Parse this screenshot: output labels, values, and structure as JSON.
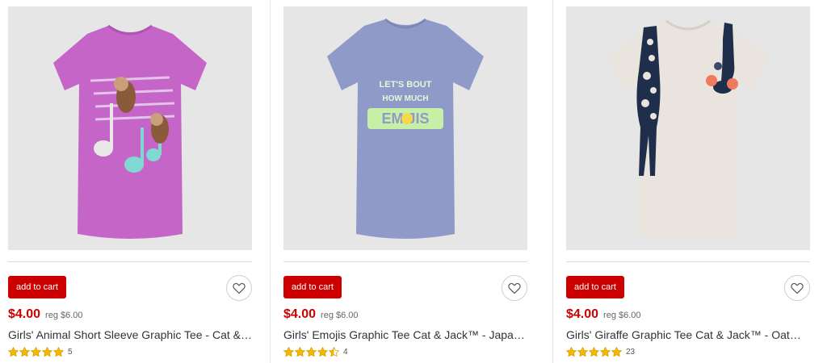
{
  "products": [
    {
      "add_to_cart_label": "add to cart",
      "price": "$4.00",
      "reg_price": "reg $6.00",
      "title": "Girls' Animal Short Sleeve Graphic Tee - Cat & Jack™ - Pink",
      "rating": 5,
      "review_count": "5",
      "shirt_color": "#c565c8",
      "image_icon": "sloth-music-notes-shirt-image"
    },
    {
      "add_to_cart_label": "add to cart",
      "price": "$4.00",
      "reg_price": "reg $6.00",
      "title": "Girls' Emojis Graphic Tee Cat & Jack™ - Japanese Blue",
      "rating": 4.5,
      "review_count": "4",
      "shirt_color": "#8f9ac9",
      "image_icon": "emojis-text-shirt-image",
      "graphic_text": {
        "line1": "LET'S  BOUT",
        "line2": "HOW MUCH",
        "line3": "EM  JIS"
      }
    },
    {
      "add_to_cart_label": "add to cart",
      "price": "$4.00",
      "reg_price": "reg $6.00",
      "title": "Girls' Giraffe Graphic Tee Cat & Jack™ - Oatmeal",
      "rating": 5,
      "review_count": "23",
      "shirt_color": "#e9e4de",
      "image_icon": "giraffe-shirt-image"
    }
  ],
  "colors": {
    "accent_red": "#cc0000",
    "star_gold": "#f5b800",
    "image_bg": "#e6e6e6"
  }
}
